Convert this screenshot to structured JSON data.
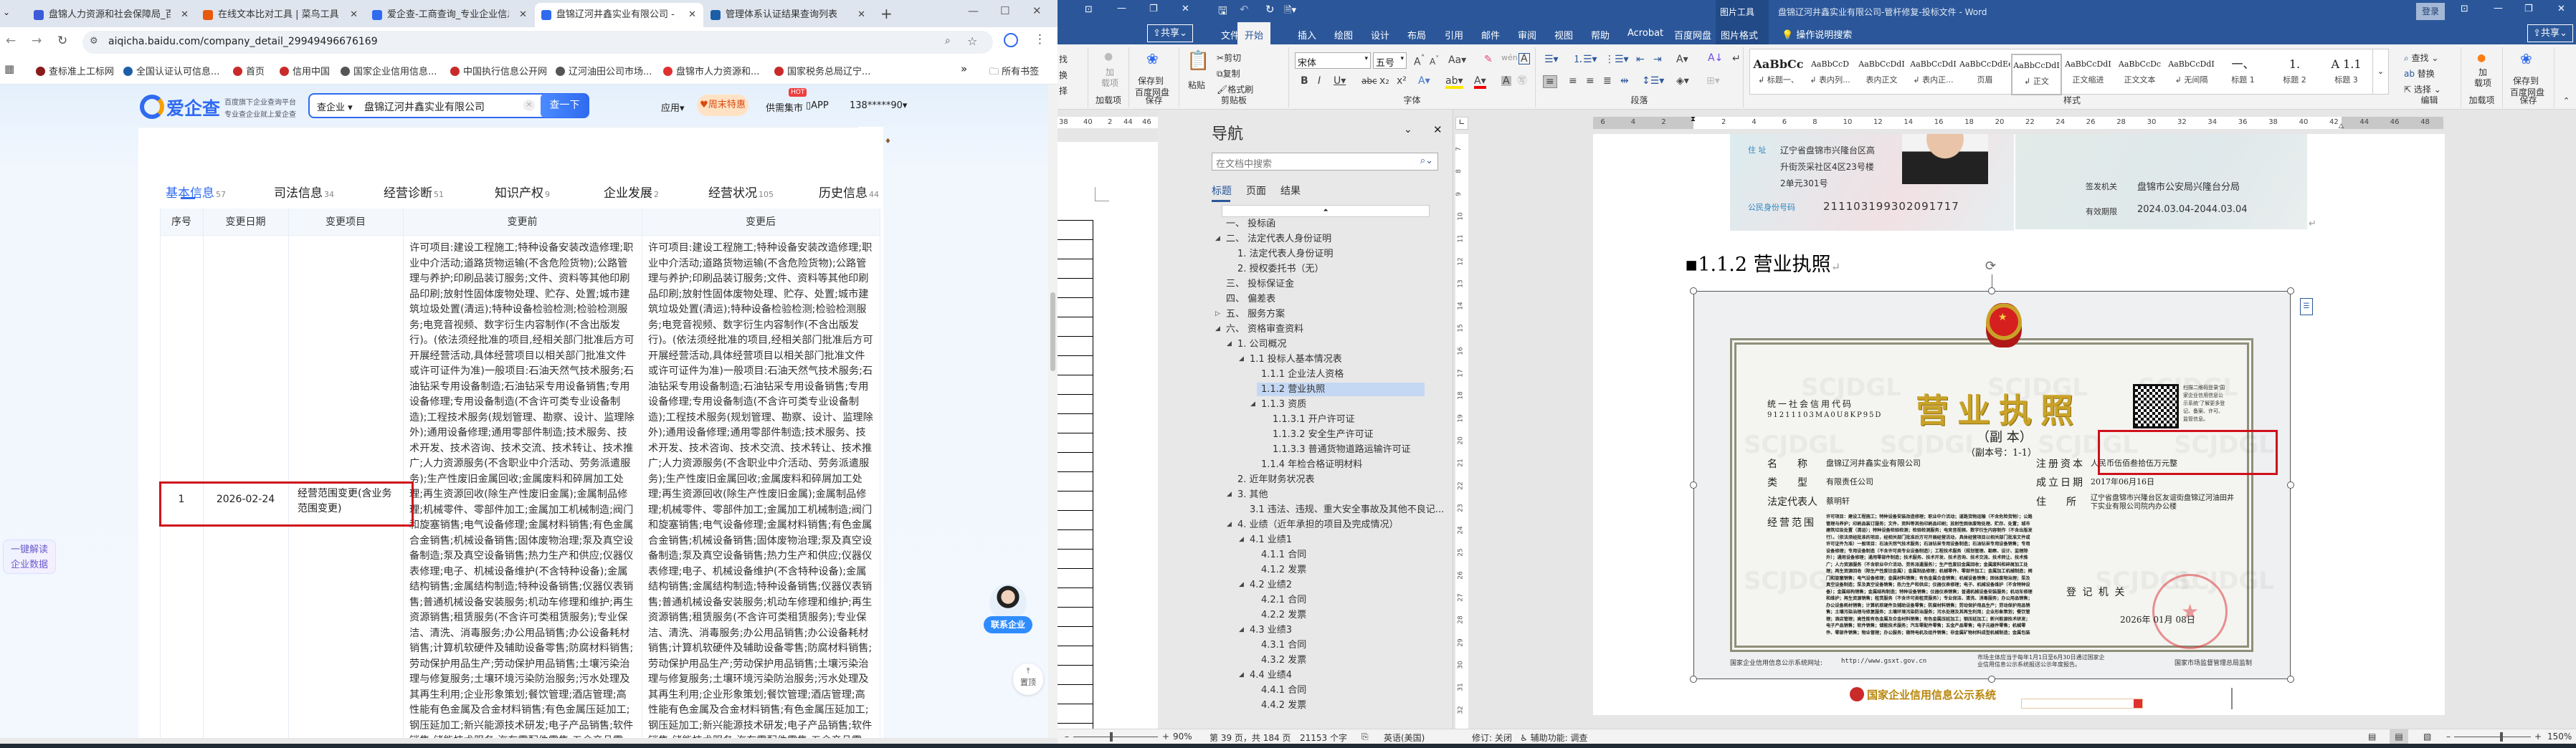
{
  "browser": {
    "tabs": [
      {
        "title": "盘锦人力资源和社会保障局_百度",
        "color": "#3b5bdb"
      },
      {
        "title": "在线文本比对工具 | 菜鸟工具",
        "color": "#e8590c"
      },
      {
        "title": "爱企查-工商查询_专业企业信息查询",
        "color": "#2f6bf0"
      },
      {
        "title": "盘锦辽河井鑫实业有限公司 - 爱企查",
        "color": "#2f6bf0",
        "active": true
      },
      {
        "title": "管理体系认证结果查询列表",
        "color": "#1c5fa8"
      }
    ],
    "url": "aiqicha.baidu.com/company_detail_29949496676169",
    "bookmarks": [
      {
        "label": "查标准上工标网",
        "color": "#8b1a1a"
      },
      {
        "label": "全国认证认可信息...",
        "color": "#1c5fa8"
      },
      {
        "label": "首页",
        "color": "#c92a2a"
      },
      {
        "label": "信用中国",
        "color": "#c92a2a"
      },
      {
        "label": "国家企业信用信息...",
        "color": "#555"
      },
      {
        "label": "中国执行信息公开网",
        "color": "#c92a2a"
      },
      {
        "label": "辽河油田公司市场...",
        "color": "#555"
      },
      {
        "label": "盘锦市人力资源和...",
        "color": "#e03131"
      },
      {
        "label": "国家税务总局辽宁...",
        "color": "#c92a2a"
      }
    ],
    "bookmarks_more": "»",
    "all_bookmarks": "所有书签"
  },
  "aiqicha": {
    "logo": "爱企查",
    "slogan_1": "百度旗下企业查询平台",
    "slogan_2": "专业查企业就上爱企查",
    "search_type": "查企业",
    "search_value": "盘锦辽河井鑫实业有限公司",
    "search_button": "查一下",
    "apps": "应用",
    "promo": "周末特惠",
    "hot": "HOT",
    "market": "供需集市",
    "app": "APP",
    "user": "138*****90",
    "tabs": [
      {
        "label": "基本信息",
        "count": "57",
        "active": true
      },
      {
        "label": "司法信息",
        "count": "34"
      },
      {
        "label": "经营诊断",
        "count": "51"
      },
      {
        "label": "知识产权",
        "count": "9"
      },
      {
        "label": "企业发展",
        "count": "2"
      },
      {
        "label": "经营状况",
        "count": "105"
      },
      {
        "label": "历史信息",
        "count": "44"
      }
    ],
    "table": {
      "headers": [
        "序号",
        "变更日期",
        "变更项目",
        "变更前",
        "变更后"
      ],
      "rows": [
        {
          "index": "1",
          "date": "2026-02-24",
          "item": "经营范围变更(含业务范围变更)",
          "before": "许可项目:建设工程施工;特种设备安装改造修理;职业中介活动;道路货物运输(不含危险货物);公路管理与养护;印刷品装订服务;文件、资料等其他印刷品印刷;放射性固体废物处理、贮存、处置;城市建筑垃圾处置(清运);特种设备检验检测;检验检测服务;电竞音视频、数字衍生内容制作(不含出版发行)。(依法须经批准的项目,经相关部门批准后方可开展经营活动,具体经营项目以相关部门批准文件或许可证件为准)一般项目:石油天然气技术服务;石油钻采专用设备制造;石油钻采专用设备销售;专用设备修理;专用设备制造(不含许可类专业设备制造);工程技术服务(规划管理、勘察、设计、监理除外);通用设备修理;通用零部件制造;技术服务、技术开发、技术咨询、技术交流、技术转让、技术推广;人力资源服务(不含职业中介活动、劳务派遣服务);生产性废旧金属回收;金属废料和碎屑加工处理;再生资源回收(除生产性废旧金属);金属制品修理;机械零件、零部件加工;金属加工机械制造;阀门和旋塞销售;电气设备修理;金属材料销售;有色金属合金销售;机械设备销售;固体废物治理;泵及真空设备制造;泵及真空设备销售;热力生产和供应;仪器仪表修理;电子、机械设备维护(不含特种设备);金属结构销售;金属结构制造;特种设备销售;仪器仪表销售;普通机械设备安装服务;机动车修理和维护;再生资源销售;租赁服务(不含许可类租赁服务);专业保洁、清洗、消毒服务;办公用品销售;办公设备耗材销售;计算机软硬件及辅助设备零售;防腐材料销售;劳动保护用品生产;劳动保护用品销售;土壤污染治理与修复服务;土壤环境污染防治服务;污水处理及其再生利用;企业形象策划;餐饮管理;酒店管理;高性能有色金属及合金材料销售;有色金属压延加工;钢压延加工;新兴能源技术研发;电子产品销售;软件销售;储能技术服务;汽车零配件零售;五金产品零售;电子元器件零售;机械零件、零部件销售;物业管理;办公服务;微特电机及组件销售;非金属矿物材料成型机械制造;金属包装容器及材料制造;家政服务;日用家电零售;日用品销售;建筑材料销售;通信设备销售;电子元器件与机电组件设备销售;电线、电缆经营;建筑装饰材料销售;建筑用钢筋产品销售;货物进出口;技术进出口;其他文化艺术经纪代理;",
          "after": "许可项目:建设工程施工;特种设备安装改造修理;职业中介活动;道路货物运输(不含危险货物);公路管理与养护;印刷品装订服务;文件、资料等其他印刷品印刷;放射性固体废物处理、贮存、处置;城市建筑垃圾处置(清运);特种设备检验检测;检验检测服务;电竞音视频、数字衍生内容制作(不含出版发行)。(依法须经批准的项目,经相关部门批准后方可开展经营活动,具体经营项目以相关部门批准文件或许可证件为准)一般项目:石油天然气技术服务;石油钻采专用设备制造;石油钻采专用设备销售;专用设备修理;专用设备制造(不含许可类专业设备制造);工程技术服务(规划管理、勘察、设计、监理除外);通用设备修理;通用零部件制造;技术服务、技术开发、技术咨询、技术交流、技术转让、技术推广;人力资源服务(不含职业中介活动、劳务派遣服务);生产性废旧金属回收;金属废料和碎屑加工处理;再生资源回收(除生产性废旧金属);金属制品修理;机械零件、零部件加工;金属加工机械制造;阀门和旋塞销售;电气设备修理;金属材料销售;有色金属合金销售;机械设备销售;固体废物治理;泵及真空设备制造;泵及真空设备销售;热力生产和供应;仪器仪表修理;电子、机械设备维护(不含特种设备);金属结构销售;金属结构制造;特种设备销售;仪器仪表销售;普通机械设备安装服务;机动车修理和维护;再生资源销售;租赁服务(不含许可类租赁服务);专业保洁、清洗、消毒服务;办公用品销售;办公设备耗材销售;计算机软硬件及辅助设备零售;防腐材料销售;劳动保护用品生产;劳动保护用品销售;土壤污染治理与修复服务;土壤环境污染防治服务;污水处理及其再生利用;企业形象策划;餐饮管理;酒店管理;高性能有色金属及合金材料销售;有色金属压延加工;钢压延加工;新兴能源技术研发;电子产品销售;软件销售;储能技术服务;汽车零配件零售;五金产品零售;电子元器件零售;机械零件、零部件销售;物业管理;办公服务;微特电机及组件销售;非金属矿物材料成型机械制造;金属包装容器及材料制造;家政服务;日用家电零售;日用品销售;建筑材料销售;通信设备销售;电子元器件与机电组件设备销售;电线、电缆经营;建筑装饰材料销售;建筑用钢筋产品销售;货物进出口;技术进出口;其他文化艺术经纪代理;"
        }
      ]
    },
    "ai_button_1": "一键解读",
    "ai_button_2": "企业数据",
    "contact": "联系企业",
    "to_top": "置顶",
    "highlight_color": "#d0101b"
  },
  "word": {
    "picture_tools": "图片工具",
    "doc_title": "盘锦辽河井鑫实业有限公司-管杆修复-投标文件  -  Word",
    "login": "登录",
    "share": "共享",
    "tabs": [
      "文件",
      "开始",
      "插入",
      "绘图",
      "设计",
      "布局",
      "引用",
      "邮件",
      "审阅",
      "视图",
      "帮助",
      "Acrobat",
      "百度网盘"
    ],
    "active_tab": "开始",
    "picture_format": "图片格式",
    "tell_me": "操作说明搜索",
    "accent": "#2b579a",
    "ribbon": {
      "partial_edit": [
        "找",
        "换",
        "择",
        "编辑"
      ],
      "addins_label": "加载项",
      "addins_button": "加\n载项",
      "save_label": "保存",
      "save_button_1": "保存到",
      "save_button_2": "百度网盘",
      "clipboard_label": "剪贴板",
      "paste": "粘贴",
      "cut": "剪切",
      "copy": "复制",
      "format_painter": "格式刷",
      "font_label": "字体",
      "font_name": "宋体",
      "font_size": "五号",
      "paragraph_label": "段落",
      "styles_label": "样式",
      "styles": [
        {
          "preview": "AaBbCc",
          "label": "↲ 标题一、"
        },
        {
          "preview": "AaBbCcD",
          "label": "↲ 表内列..."
        },
        {
          "preview": "AaBbCcDdI",
          "label": "表内正文"
        },
        {
          "preview": "AaBbCcDdI",
          "label": "↲ 表内正..."
        },
        {
          "preview": "AaBbCcDdEe",
          "label": "页眉"
        },
        {
          "preview": "AaBbCcDdI",
          "label": "↲ 正文",
          "selected": true
        },
        {
          "preview": "AaBbCcDdI",
          "label": "正文缩进"
        },
        {
          "preview": "AaBbCcDc",
          "label": "正文文本"
        },
        {
          "preview": "AaBbCcDdI",
          "label": "↲ 无间隔"
        },
        {
          "preview": "一、",
          "label": "标题 1"
        },
        {
          "preview": "1.",
          "label": "标题 2"
        },
        {
          "preview": "A 1.1",
          "label": "标题 3"
        }
      ],
      "editing_label": "编辑",
      "find": "查找",
      "replace": "替换",
      "select": "选择"
    },
    "nav": {
      "title": "导航",
      "search_placeholder": "在文档中搜索",
      "tabs": [
        "标题",
        "页面",
        "结果"
      ],
      "items": [
        {
          "label": "一、  投标函",
          "level": 0
        },
        {
          "label": "二、  法定代表人身份证明",
          "level": 0,
          "toggle": "expanded"
        },
        {
          "label": "1. 法定代表人身份证明",
          "level": 1
        },
        {
          "label": "2. 授权委托书（无）",
          "level": 1
        },
        {
          "label": "三、  投标保证金",
          "level": 0
        },
        {
          "label": "四、  偏差表",
          "level": 0
        },
        {
          "label": "五、  服务方案",
          "level": 0,
          "toggle": "collapsed"
        },
        {
          "label": "六、  资格审查资料",
          "level": 0,
          "toggle": "expanded"
        },
        {
          "label": "1. 公司概况",
          "level": 1,
          "toggle": "expanded"
        },
        {
          "label": "1.1 投标人基本情况表",
          "level": 2,
          "toggle": "expanded"
        },
        {
          "label": "1.1.1 企业法人资格",
          "level": 3
        },
        {
          "label": "1.1.2 营业执照",
          "level": 3,
          "selected": true
        },
        {
          "label": "1.1.3 资质",
          "level": 3,
          "toggle": "expanded"
        },
        {
          "label": "1.1.3.1 开户许可证",
          "level": 4
        },
        {
          "label": "1.1.3.2 安全生产许可证",
          "level": 4
        },
        {
          "label": "1.1.3.3 普通货物道路运输许可证",
          "level": 4
        },
        {
          "label": "1.1.4 年检合格证明材料",
          "level": 3
        },
        {
          "label": "2. 近年财务状况表",
          "level": 1
        },
        {
          "label": "3. 其他",
          "level": 1,
          "toggle": "expanded"
        },
        {
          "label": "3.1 违法、违规、重大安全事故及其他不良记...",
          "level": 2
        },
        {
          "label": "4. 业绩（近年承担的项目及完成情况）",
          "level": 1,
          "toggle": "expanded"
        },
        {
          "label": "4.1 业绩1",
          "level": 2,
          "toggle": "expanded"
        },
        {
          "label": "4.1.1 合同",
          "level": 3
        },
        {
          "label": "4.1.2 发票",
          "level": 3
        },
        {
          "label": "4.2 业绩2",
          "level": 2,
          "toggle": "expanded"
        },
        {
          "label": "4.2.1 合同",
          "level": 3
        },
        {
          "label": "4.2.2 发票",
          "level": 3
        },
        {
          "label": "4.3 业绩3",
          "level": 2,
          "toggle": "expanded"
        },
        {
          "label": "4.3.1 合同",
          "level": 3
        },
        {
          "label": "4.3.2 发票",
          "level": 3
        },
        {
          "label": "4.4 业绩4",
          "level": 2,
          "toggle": "expanded"
        },
        {
          "label": "4.4.1 合同",
          "level": 3
        },
        {
          "label": "4.4.2 发票",
          "level": 3
        }
      ]
    },
    "back_ruler": [
      "38",
      "40",
      "2",
      "44",
      "46",
      "48"
    ],
    "vertical_ruler": [
      "7",
      "8",
      "9",
      "10",
      "11",
      "12",
      "13",
      "14",
      "15",
      "16",
      "17",
      "18",
      "19",
      "20",
      "21",
      "22",
      "23",
      "24",
      "25",
      "26",
      "27",
      "28",
      "29",
      "30",
      "31",
      "32"
    ],
    "horizontal_ruler_left": [
      "6",
      "4",
      "2"
    ],
    "horizontal_ruler": [
      "2",
      "4",
      "6",
      "8",
      "10",
      "12",
      "14",
      "16",
      "18",
      "20",
      "22",
      "24",
      "26",
      "28",
      "30",
      "32",
      "34",
      "36",
      "38",
      "40",
      "42",
      "44",
      "46",
      "48"
    ],
    "document": {
      "heading": "1.1.2 营业执照",
      "id_card": {
        "address_label": "住 址",
        "address_lines": [
          "辽宁省盘锦市兴隆台区高",
          "升街茨采社区4区23号楼",
          "2单元301号"
        ],
        "id_label": "公民身份号码",
        "id_number": "211103199302091717",
        "authority_label": "签发机关",
        "authority": "盘锦市公安局兴隆台分局",
        "validity_label": "有效期限",
        "validity": "2024.03.04-2044.03.04"
      },
      "license": {
        "title": "营业执照",
        "copy": "（副 本）",
        "copy_no": "（副本号：1-1）",
        "code_label": "统一社会信用代码",
        "code": "91211103MA0U8KP95D",
        "qr_note": "扫描二维码登录‘国家企业信用信息公示系统’了解更多登记、备案、许可、监管信息。",
        "name_label": "名　　称",
        "name": "盘锦辽河井鑫实业有限公司",
        "type_label": "类　　型",
        "type": "有限责任公司",
        "rep_label": "法定代表人",
        "rep": "蔡明轩",
        "scope_label": "经营范围",
        "scope": "许可项目：建设工程施工；特种设备安装改造修理；职业中介活动；道路货物运输（不含危险货物）；公路管理与养护；印刷品装订服务；文件、资料等其他印刷品印刷；放射性固体废物处理、贮存、处置；城市建筑垃圾处置（清运）；特种设备检验检测；检验检测服务；电竞音视频、数字衍生内容制作（不含出版发行）。（依法须经批准的项目，经相关部门批准后方可开展经营活动，具体经营项目以相关部门批准文件或许可证件为准）一般项目：石油天然气技术服务；石油钻采专用设备制造；石油钻采专用设备销售；专用设备修理；专用设备制造（不含许可类专业设备制造）；工程技术服务（规划管理、勘察、设计、监理除外）；通用设备修理；通用零部件制造；技术服务、技术开发、技术咨询、技术交流、技术转让、技术推广；人力资源服务（不含职业中介活动、劳务派遣服务）；生产性废旧金属回收；金属废料和碎屑加工处理；再生资源回收（除生产性废旧金属）；金属制品修理；机械零件、零部件加工；金属加工机械制造；阀门和旋塞销售；电气设备修理；金属材料销售；有色金属合金销售；机械设备销售；固体废物治理；泵及真空设备制造；泵及真空设备销售；热力生产和供应；仪器仪表修理；电子、机械设备维护（不含特种设备）；金属结构销售；金属结构制造；特种设备销售；仪器仪表销售；普通机械设备安装服务；机动车修理和维护；再生资源销售；租赁服务（不含许可类租赁服务）；专业保洁、清洗、消毒服务；办公用品销售；办公设备耗材销售；计算机软硬件及辅助设备零售；防腐材料销售；劳动保护用品生产；劳动保护用品销售；土壤污染治理与修复服务；土壤环境污染防治服务；污水处理及其再生利用；企业形象策划；餐饮管理；酒店管理；高性能有色金属及合金材料销售；有色金属压延加工；钢压延加工；新兴能源技术研发；电子产品销售；软件销售；储能技术服务；汽车零配件零售；五金产品零售；电子元器件零售；机械零件、零部件销售；物业管理；办公服务；微特电机及组件销售；非金属矿物材料成型机械制造；金属包装容器及材料制造；家政服务；日用家电零售；日用品销售；建筑材料销售；通信设备销售；电子元器件与机电组件设备销售；电线、电缆经营；建筑装饰材料销售；建筑用钢筋产品销售；货物进出口；技术进出口；其他文化艺术经纪代理；软件开发（除依法须经批准的项目外，凭营业执照依法自主开展经营活动）",
        "capital_label": "注册资本",
        "capital": "人民币伍佰叁拾伍万元整",
        "date_label": "成立日期",
        "date": "2017年06月16日",
        "address_label": "住　　所",
        "address": "辽宁省盘锦市兴隆台区友谊街盘锦辽河油田井下实业有限公司院内办公楼",
        "authority": "登 记 机 关",
        "issue_date": "2026年  01月  08日",
        "footer_site_label": "国家企业信用信息公示系统网址:",
        "footer_site": "http://www.gsxt.gov.cn",
        "footer_note": "市场主体应当于每年1月1日至6月30日通过国家企业信用信息公示系统报送公示年度报告。",
        "footer_maker": "国家市场监督管理总局监制",
        "watermark": "SCJDGL"
      },
      "gsxt_banner": "国家企业信用信息公示系统"
    },
    "status": {
      "zoom_left": "90%",
      "page": "第 39 页，共 184 页",
      "words": "21153 个字",
      "language": "英语(美国)",
      "track_changes": "修订: 关闭",
      "accessibility": "辅助功能: 调查",
      "zoom": "150%",
      "zoom_left_level": 0.45,
      "zoom_level": 0.62
    }
  }
}
